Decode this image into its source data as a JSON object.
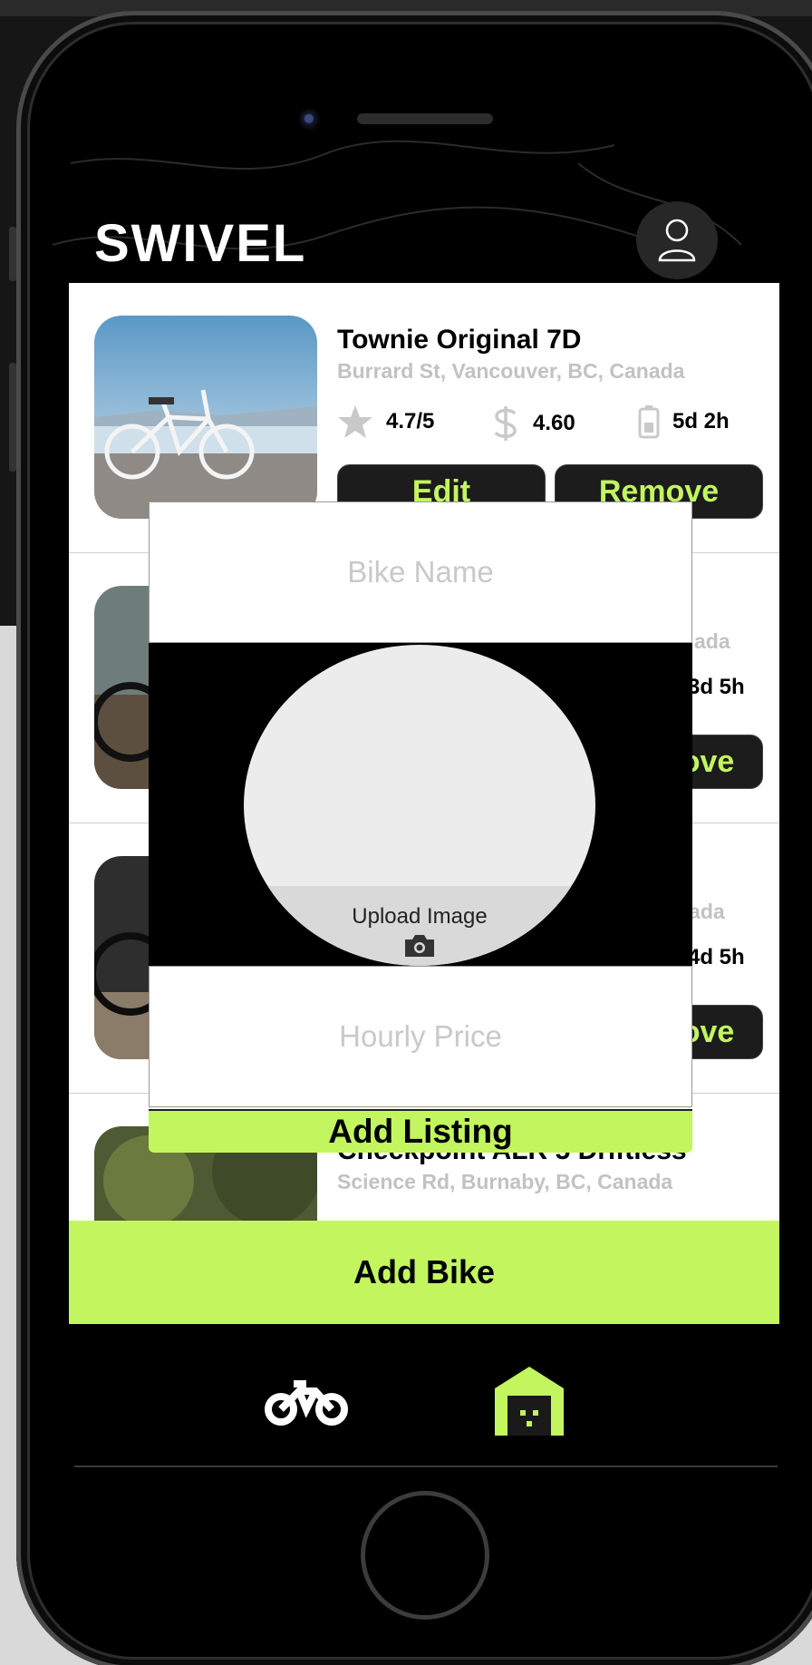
{
  "app": {
    "brand": "SWIVEL"
  },
  "listings": [
    {
      "title": "Townie Original 7D",
      "address": "Burrard St, Vancouver, BC, Canada",
      "rating": "4.7/5",
      "price": "4.60",
      "battery": "5d 2h",
      "edit_label": "Edit",
      "remove_label": "Remove"
    },
    {
      "address": "ada",
      "battery": "3d 5h",
      "remove_label": "ove"
    },
    {
      "address": "nada",
      "battery": "4d 5h",
      "remove_label": "ove"
    },
    {
      "title": "Checkpoint ALR 5 Driftless",
      "address": "Science Rd, Burnaby, BC, Canada"
    }
  ],
  "add_bike_label": "Add Bike",
  "modal": {
    "bike_name_placeholder": "Bike Name",
    "upload_label": "Upload Image",
    "hourly_price_placeholder": "Hourly Price",
    "add_listing_label": "Add Listing"
  },
  "icons": {
    "profile": "user-icon",
    "rating": "star-icon",
    "price": "dollar-icon",
    "battery": "battery-icon",
    "upload": "camera-icon",
    "tab_bikes": "bike-icon",
    "tab_garage": "garage-icon"
  },
  "colors": {
    "accent": "#c3f55f",
    "dark": "#1c1c1c",
    "muted_text": "#c2c2c2"
  }
}
